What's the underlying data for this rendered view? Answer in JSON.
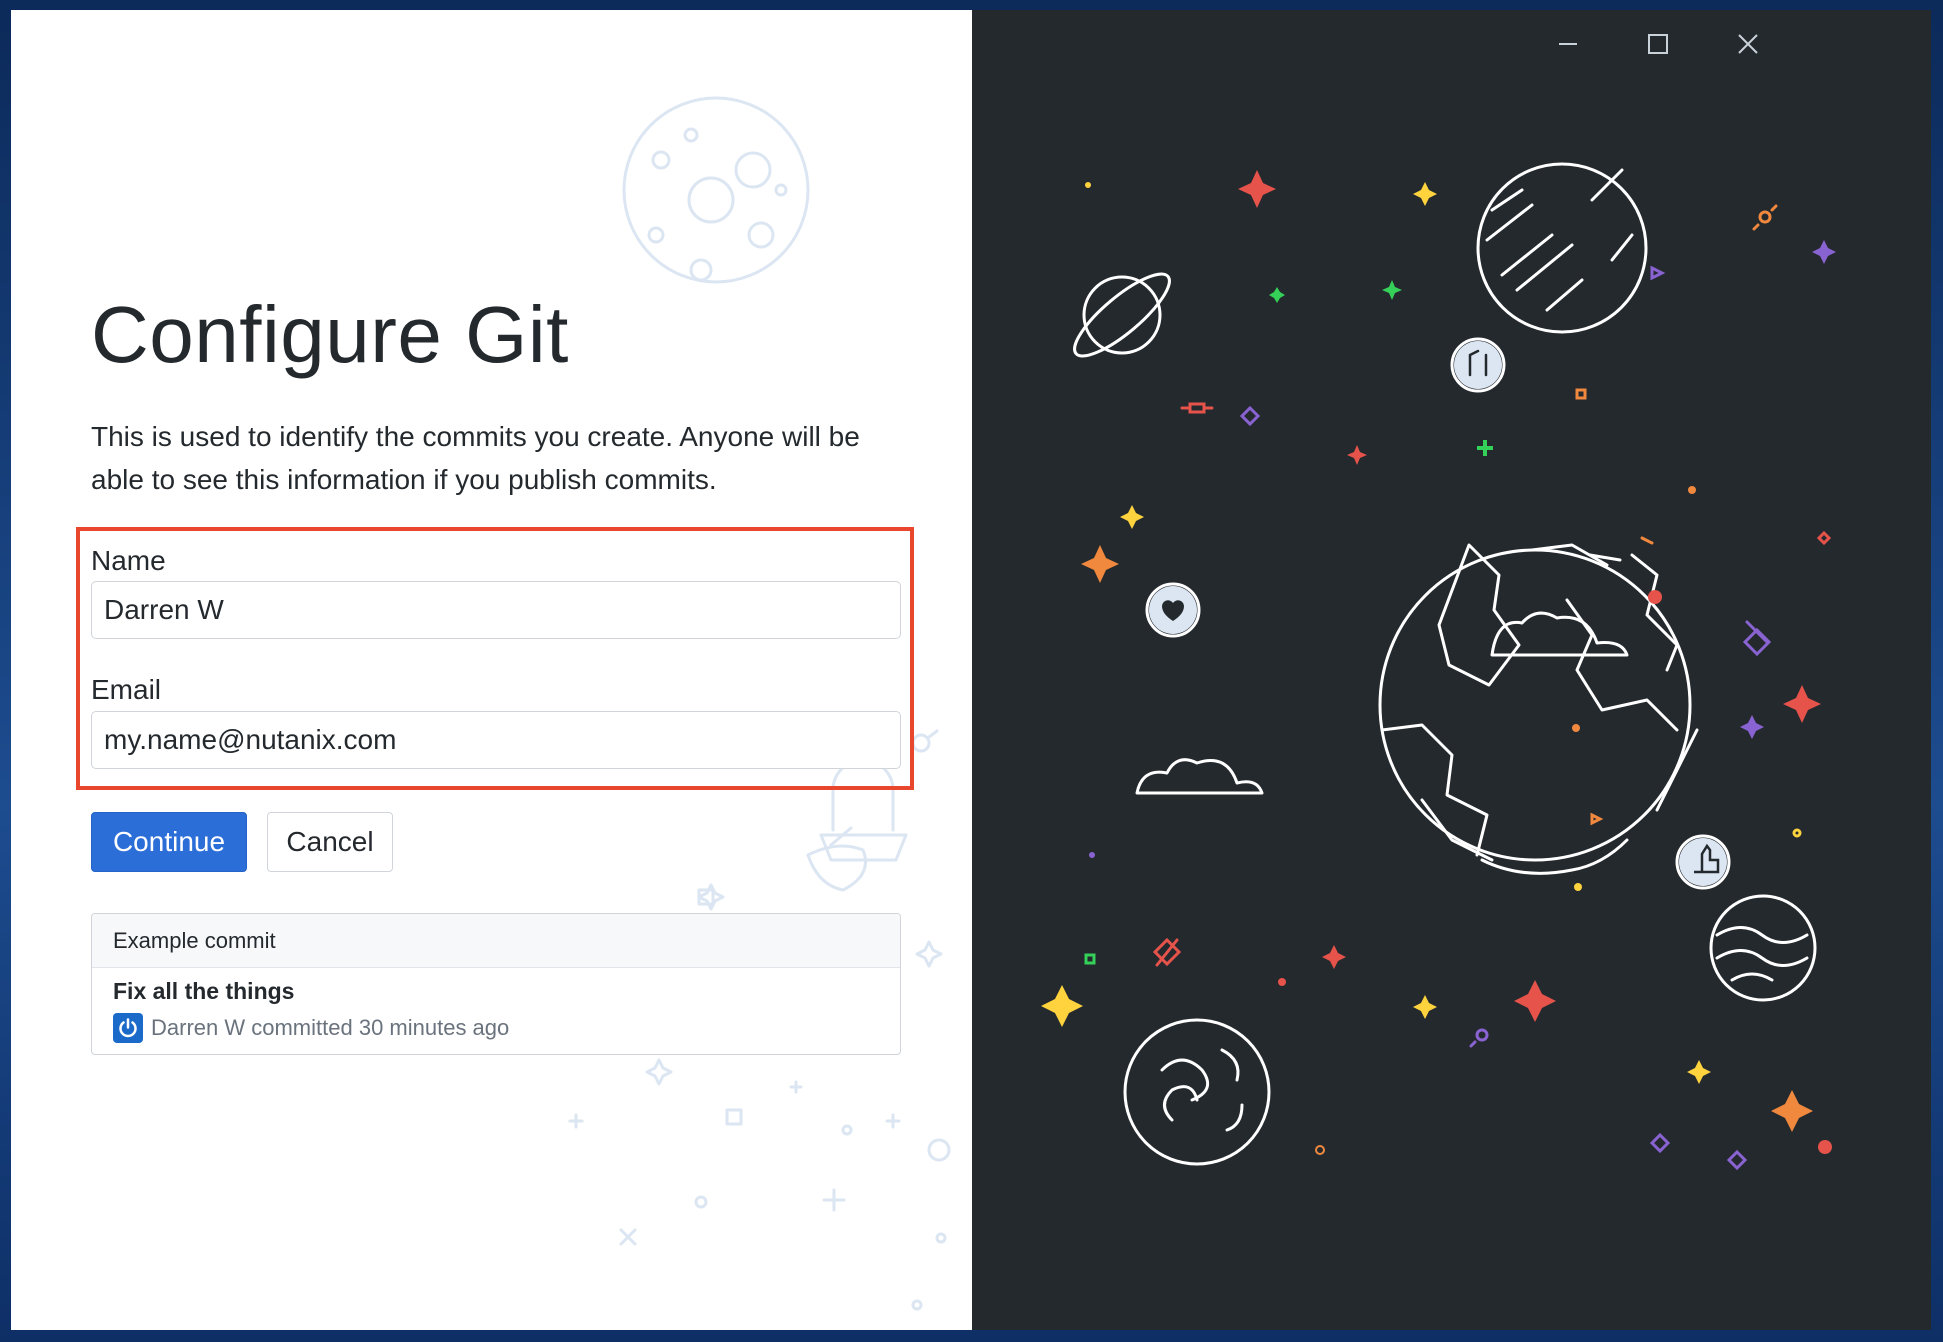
{
  "window": {
    "controls": {
      "minimize_icon": "minimize-icon",
      "maximize_icon": "maximize-icon",
      "close_icon": "close-icon"
    }
  },
  "main": {
    "title": "Configure Git",
    "description": "This is used to identify the commits you create. Anyone will be able to see this information if you publish commits.",
    "name_label": "Name",
    "name_value": "Darren W",
    "email_label": "Email",
    "email_value": "my.name@nutanix.com",
    "continue_label": "Continue",
    "cancel_label": "Cancel"
  },
  "example_commit": {
    "header": "Example commit",
    "title": "Fix all the things",
    "author": "Darren W",
    "meta": "committed 30 minutes ago"
  },
  "colors": {
    "primary": "#2b6ed7",
    "highlight": "#e8472e",
    "dark_panel": "#24292e"
  }
}
